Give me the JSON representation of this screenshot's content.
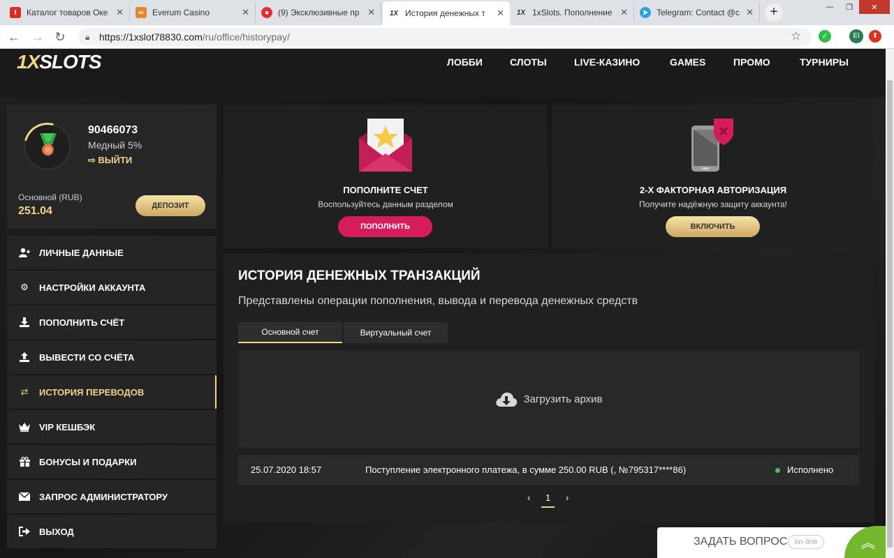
{
  "browser": {
    "tabs": [
      {
        "title": "Каталог товаров Оке",
        "favicon_color": "#d62d20"
      },
      {
        "title": "Everum Casino",
        "favicon_color": "#e08a2f"
      },
      {
        "title": "(9) Эксклюзивные пр",
        "favicon_color": "#d33"
      },
      {
        "title": "История денежных т",
        "favicon_color": "#333"
      },
      {
        "title": "1xSlots. Пополнение",
        "favicon_color": "#333"
      },
      {
        "title": "Telegram: Contact @c",
        "favicon_color": "#2aa3dc"
      }
    ],
    "url_host": "https://1xslot78830.com",
    "url_path": "/ru/office/historypay/",
    "profile_initials": "El"
  },
  "site": {
    "logo_prefix": "1X",
    "logo_suffix": "SLOTS",
    "nav": [
      "ЛОББИ",
      "СЛОТЫ",
      "LIVE-КАЗИНО",
      "GAMES",
      "ПРОМО",
      "ТУРНИРЫ"
    ]
  },
  "profile": {
    "id": "90466073",
    "level": "Медный 5%",
    "logout": "ВЫЙТИ",
    "balance_title": "Основной (RUB)",
    "balance": "251.04",
    "deposit_btn": "ДЕПОЗИТ"
  },
  "sidebar": {
    "items": [
      {
        "label": "ЛИЧНЫЕ ДАННЫЕ",
        "icon": "user-plus-icon",
        "active": false
      },
      {
        "label": "НАСТРОЙКИ АККАУНТА",
        "icon": "gears-icon",
        "active": false
      },
      {
        "label": "ПОПОЛНИТЬ СЧЁТ",
        "icon": "download-icon",
        "active": false
      },
      {
        "label": "ВЫВЕСТИ СО СЧЁТА",
        "icon": "upload-icon",
        "active": false
      },
      {
        "label": "ИСТОРИЯ ПЕРЕВОДОВ",
        "icon": "exchange-icon",
        "active": true
      },
      {
        "label": "VIP КЕШБЭК",
        "icon": "crown-icon",
        "active": false
      },
      {
        "label": "БОНУСЫ И ПОДАРКИ",
        "icon": "gift-icon",
        "active": false
      },
      {
        "label": "ЗАПРОС АДМИНИСТРАТОРУ",
        "icon": "envelope-icon",
        "active": false
      },
      {
        "label": "ВЫХОД",
        "icon": "sign-out-icon",
        "active": false
      }
    ]
  },
  "promo_deposit": {
    "title": "ПОПОЛНИТЕ СЧЕТ",
    "subtitle": "Воспользуйтесь данным разделом",
    "button": "ПОПОЛНИТЬ"
  },
  "promo_2fa": {
    "title": "2-Х ФАКТОРНАЯ АВТОРИЗАЦИЯ",
    "subtitle": "Получите надёжную защиту аккаунта!",
    "button": "ВКЛЮЧИТЬ"
  },
  "history": {
    "title": "ИСТОРИЯ ДЕНЕЖНЫХ ТРАНЗАКЦИЙ",
    "subtitle": "Представлены операции пополнения, вывода и перевода денежных средств",
    "tabs": [
      "Основной счет",
      "Виртуальный счет"
    ],
    "archive": "Загрузить архив",
    "rows": [
      {
        "date": "25.07.2020 18:57",
        "desc": "Поступление электронного платежа, в сумме 250.00 RUB (, №795317****86)",
        "status": "Исполнено"
      }
    ],
    "page": "1",
    "prev": "‹",
    "next": "›"
  },
  "chat": {
    "ask": "ЗАДАТЬ ВОПРОС",
    "status": "on-line"
  },
  "colors": {
    "accent_gold": "#f2d48a",
    "pink": "#d41d5a",
    "status_green": "#3fc558"
  }
}
